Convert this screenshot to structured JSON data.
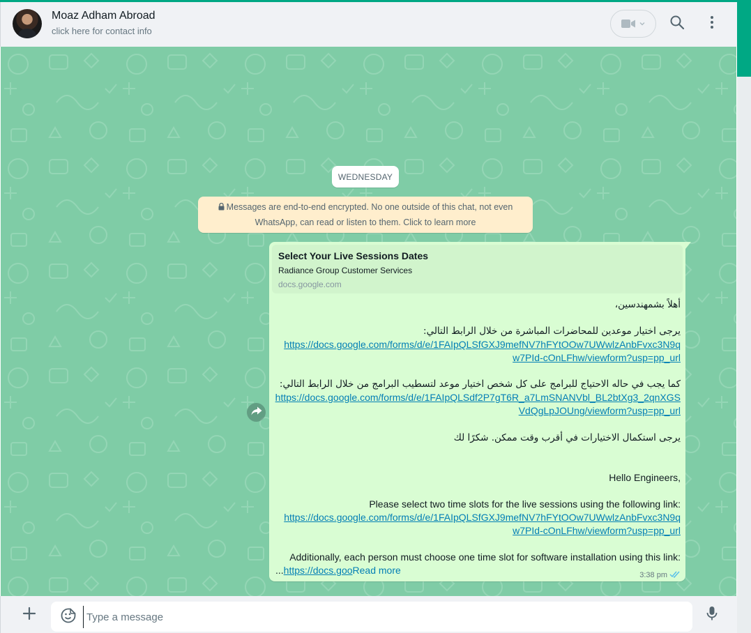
{
  "header": {
    "contact_name": "Moaz Adham Abroad",
    "contact_subtitle": "click here for contact info"
  },
  "chat": {
    "day_label": "WEDNESDAY",
    "encryption_notice": "Messages are end-to-end encrypted. No one outside of this chat, not even WhatsApp, can read or listen to them. Click to learn more",
    "message": {
      "link_preview": {
        "title": "Select Your Live Sessions Dates",
        "description": "Radiance Group Customer Services",
        "domain": "docs.google.com"
      },
      "lines": {
        "ar_greeting": "أهلاً بشمهندسين،",
        "ar_instruction1": "يرجى اختيار موعدين للمحاضرات المباشرة من خلال الرابط التالي:",
        "link1_part1": "https://docs.google.com/forms/d/e/1FAIpQLSfGXJ9mefNV7hFYtOOw7UWwlzAnbFvxc3N9q",
        "link1_part2": "w7PId-cOnLFhw/viewform?usp=pp_url",
        "ar_instruction2": "كما يجب في حاله الاحتياج للبرامج على كل شخص اختيار موعد لتسطيب البرامج من خلال الرابط التالي:",
        "link2_part1": "https://docs.google.com/forms/d/e/1FAIpQLSdf2P7gT6R_a7LmSNANVbl_BL2btXg3_2qnXGS",
        "link2_part2": "VdQgLpJOUng/viewform?usp=pp_url",
        "ar_closing": "يرجى استكمال الاختيارات في أقرب وقت ممكن. شكرًا لك",
        "en_greeting": "Hello Engineers,",
        "en_instruction1": "Please select two time slots for the live sessions using the following link:",
        "link3_part1": "https://docs.google.com/forms/d/e/1FAIpQLSfGXJ9mefNV7hFYtOOw7UWwlzAnbFvxc3N9q",
        "link3_part2": "w7PId-cOnLFhw/viewform?usp=pp_url",
        "en_instruction2": "Additionally, each person must choose one time slot for software installation using this link:",
        "truncated_link": "https://docs.goo",
        "ellipsis": "...",
        "read_more": "Read more"
      },
      "time": "3:38 pm",
      "status": "read-double-tick"
    }
  },
  "composer": {
    "placeholder": "Type a message"
  },
  "colors": {
    "accent": "#00a884",
    "chat_background": "#7fcca6",
    "outgoing_bubble": "#d9fdd3",
    "link": "#027eb5",
    "notice_background": "#ffeecd"
  },
  "icons": {
    "video": "video-call-icon",
    "dropdown": "chevron-down-icon",
    "search": "search-icon",
    "menu": "kebab-menu-icon",
    "lock": "lock-icon",
    "forward": "forward-icon",
    "ticks": "double-tick-icon",
    "attach": "plus-icon",
    "emoji": "sticker-icon",
    "mic": "microphone-icon"
  }
}
